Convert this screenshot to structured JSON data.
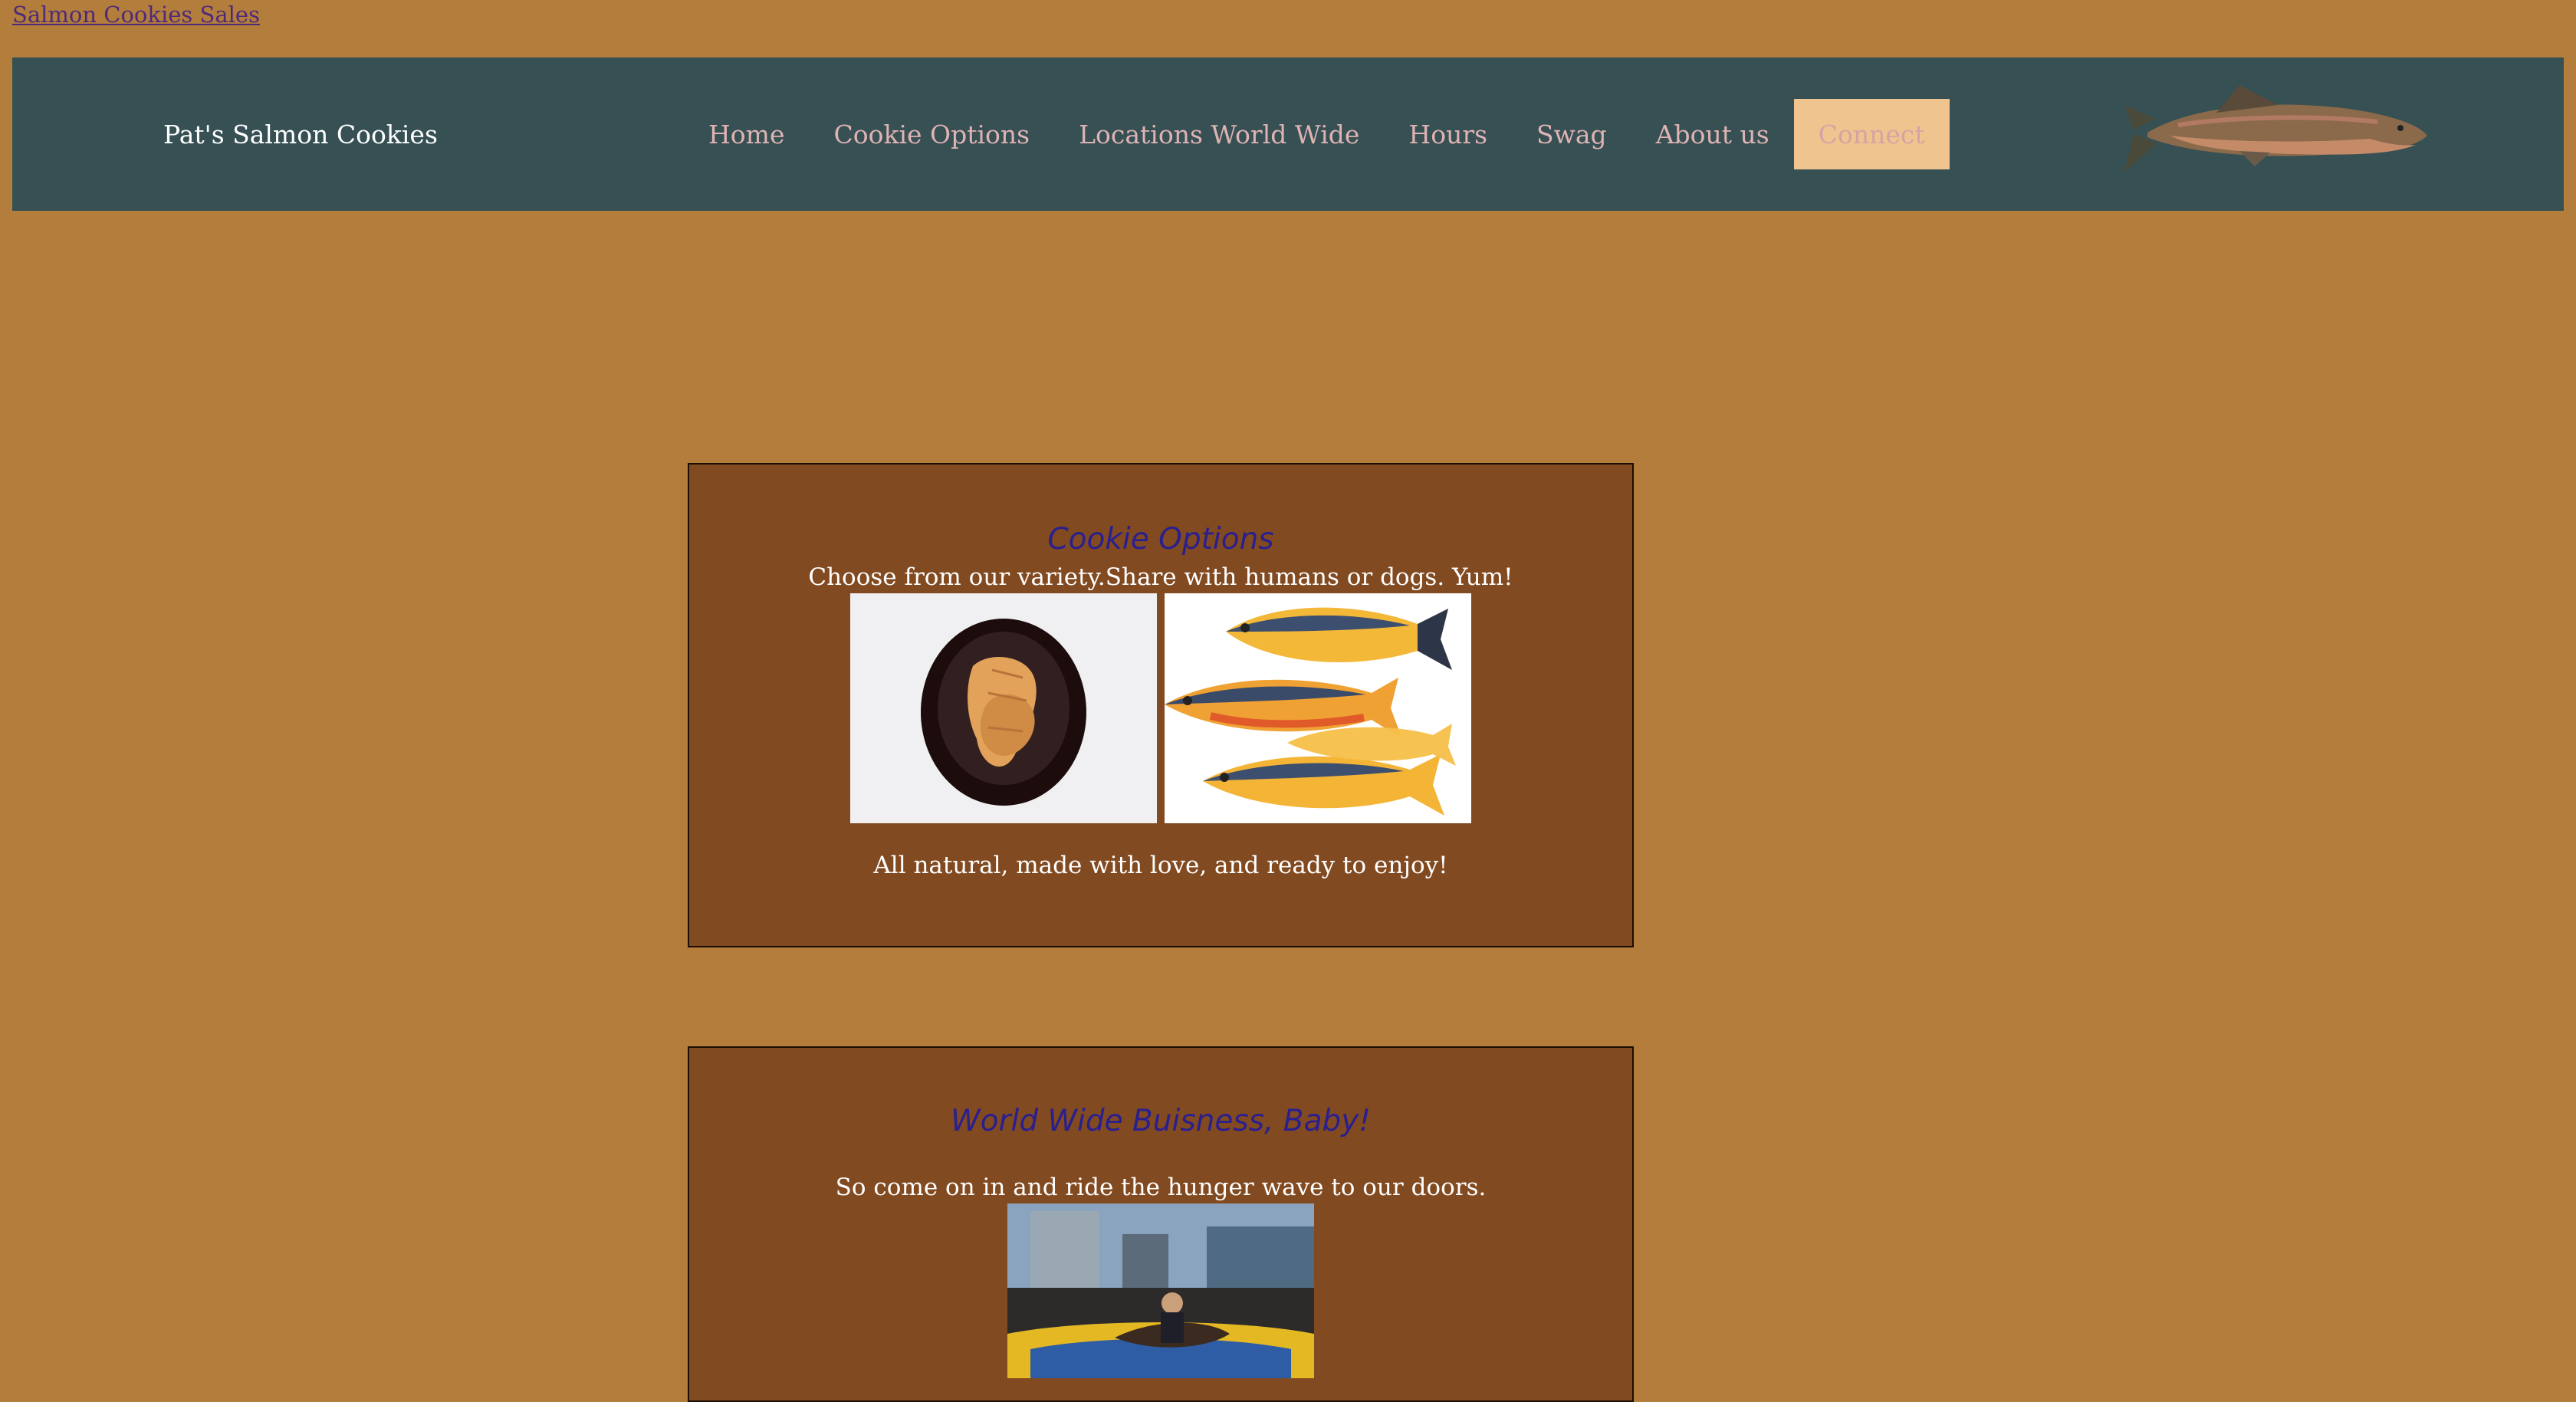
{
  "top_link": {
    "label": "Salmon Cookies Sales"
  },
  "navbar": {
    "brand": "Pat's Salmon Cookies",
    "items": [
      {
        "label": "Home"
      },
      {
        "label": "Cookie Options"
      },
      {
        "label": "Locations World Wide"
      },
      {
        "label": "Hours"
      },
      {
        "label": "Swag"
      },
      {
        "label": "About us"
      }
    ],
    "connect_label": "Connect"
  },
  "colors": {
    "page_background": "#b37d3b",
    "navbar_background": "#365054",
    "card_background": "#824a20",
    "heading": "#2a1f8f",
    "nav_link": "#dfb3b3",
    "connect_background": "#f0c48f"
  },
  "cookie_options": {
    "title": "Cookie Options",
    "subtitle": "Choose from our variety.Share with humans or dogs. Yum!",
    "footer": "All natural, made with love, and ready to enjoy!",
    "images": [
      "plate-of-fish-shaped-cookies",
      "three-painted-fish"
    ]
  },
  "world_wide": {
    "title": "World Wide Buisness, Baby!",
    "subtitle": "So come on in and ride the hunger wave to our doors.",
    "image": "mechanical-salmon-ride-crowd"
  }
}
